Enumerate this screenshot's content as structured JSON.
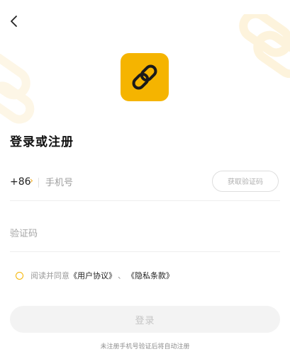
{
  "header": {
    "back_icon": "chevron-left-icon"
  },
  "logo": {
    "icon": "link-icon",
    "color": "#f5b400"
  },
  "title": "登录或注册",
  "phone": {
    "country_code": "+86",
    "country_arrow": "›",
    "placeholder": "手机号",
    "get_code_label": "获取验证码"
  },
  "code": {
    "placeholder": "验证码"
  },
  "agreement": {
    "prefix": "阅读并同意",
    "user_agreement": "《用户协议》",
    "separator": "、",
    "privacy_policy": "《隐私条款》",
    "checked": false
  },
  "login_button_label": "登录",
  "footnote": "未注册手机号验证后将自动注册",
  "colors": {
    "accent": "#f5b400",
    "disabled_button_bg": "#f3f3f3",
    "disabled_button_text": "#c4c4c4"
  }
}
